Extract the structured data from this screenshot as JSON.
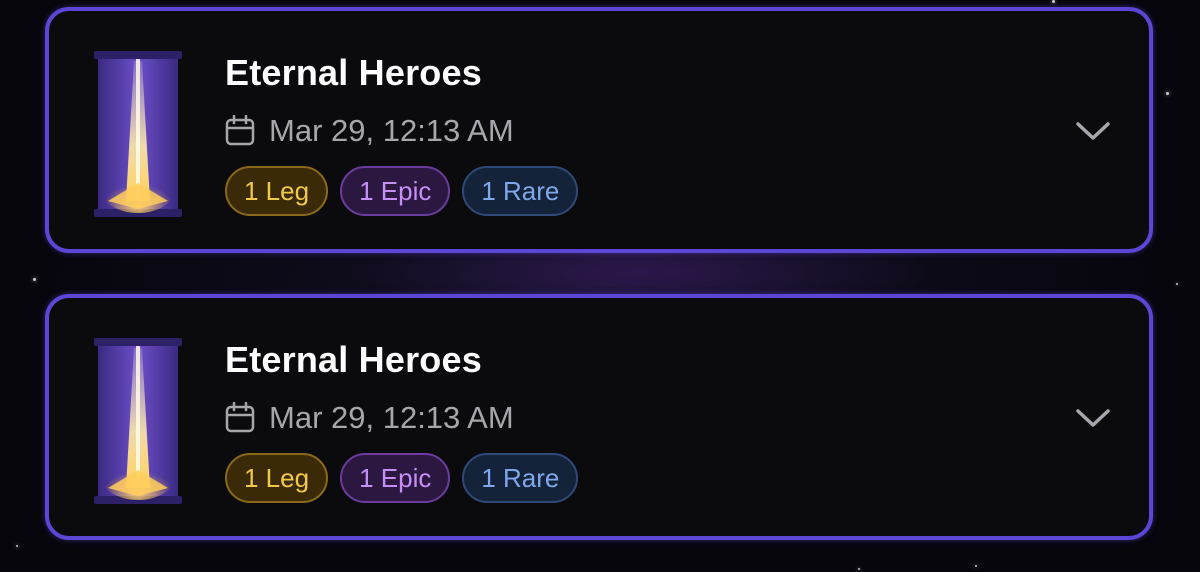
{
  "cards": [
    {
      "title": "Eternal Heroes",
      "date": "Mar 29, 12:13 AM",
      "badges": {
        "leg": "1 Leg",
        "epic": "1 Epic",
        "rare": "1 Rare"
      },
      "icon": "card-pack-image",
      "expand_icon": "chevron-down-icon"
    },
    {
      "title": "Eternal Heroes",
      "date": "Mar 29, 12:13 AM",
      "badges": {
        "leg": "1 Leg",
        "epic": "1 Epic",
        "rare": "1 Rare"
      },
      "icon": "card-pack-image",
      "expand_icon": "chevron-down-icon"
    }
  ],
  "colors": {
    "card_border": "#5b46d6",
    "card_background": "#0b0b0d",
    "legendary": "#f0c84a",
    "epic": "#c590f5",
    "rare": "#7fa8ea"
  }
}
